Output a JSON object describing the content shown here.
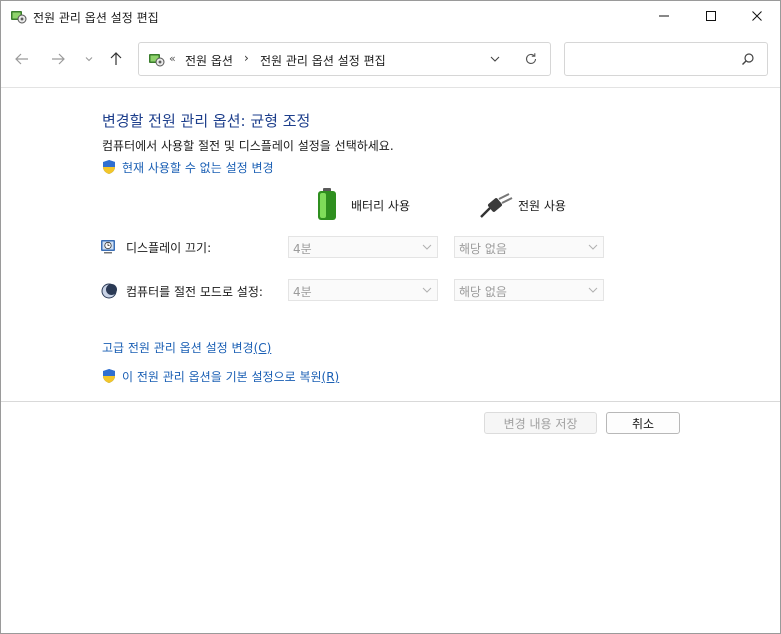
{
  "window": {
    "title": "전원 관리 옵션 설정 편집"
  },
  "navigation": {
    "breadcrumb_prefix": "«",
    "breadcrumbs": [
      "전원 옵션",
      "전원 관리 옵션 설정 편집"
    ],
    "breadcrumb_separator": "›",
    "search_placeholder": ""
  },
  "content": {
    "heading": "변경할 전원 관리 옵션: 균형 조정",
    "description": "컴퓨터에서 사용할 절전 및 디스플레이 설정을 선택하세요.",
    "change_unavailable_link": "현재 사용할 수 없는 설정 변경",
    "columns": {
      "battery": "배터리 사용",
      "plugged_in": "전원 사용"
    },
    "settings": [
      {
        "label": "디스플레이 끄기:",
        "battery_value": "4분",
        "plugged_value": "해당 없음",
        "icon": "display-clock-icon"
      },
      {
        "label": "컴퓨터를 절전 모드로 설정:",
        "battery_value": "4분",
        "plugged_value": "해당 없음",
        "icon": "sleep-moon-icon"
      }
    ],
    "advanced_link": "고급 전원 관리 옵션 설정 변경",
    "advanced_link_key": "(C)",
    "restore_link": "이 전원 관리 옵션을 기본 설정으로 복원",
    "restore_link_key": "(R)"
  },
  "buttons": {
    "save": "변경 내용 저장",
    "cancel": "취소"
  },
  "colors": {
    "heading": "#1e3f8c",
    "link": "#1a5fb4",
    "disabled_text": "#9b9b9b"
  }
}
